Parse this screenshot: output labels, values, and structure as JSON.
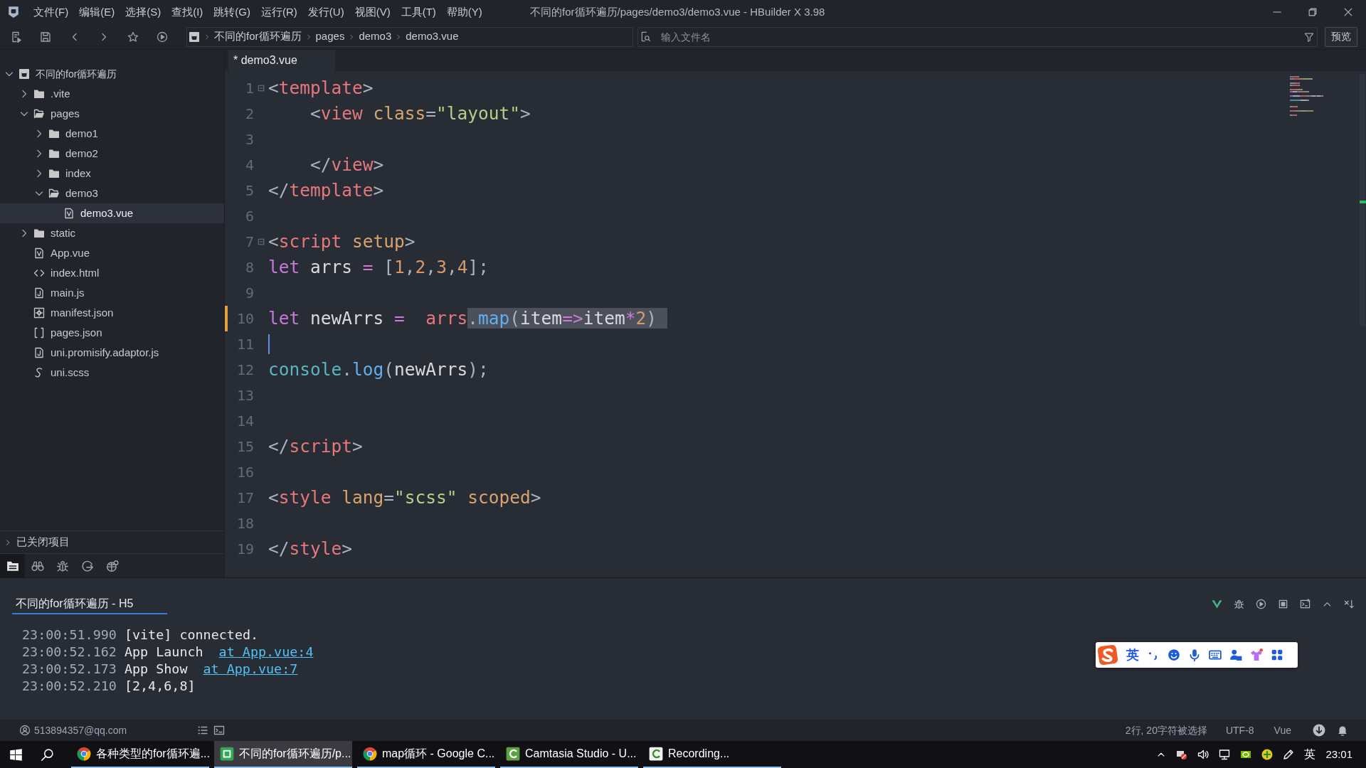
{
  "title_bar": {
    "menu": [
      "文件(F)",
      "编辑(E)",
      "选择(S)",
      "查找(I)",
      "跳转(G)",
      "运行(R)",
      "发行(U)",
      "视图(V)",
      "工具(T)",
      "帮助(Y)"
    ],
    "title": "不同的for循环遍历/pages/demo3/demo3.vue - HBuilder X 3.98"
  },
  "toolbar": {
    "breadcrumb": [
      "不同的for循环遍历",
      "pages",
      "demo3",
      "demo3.vue"
    ],
    "file_search": {
      "placeholder": "输入文件名"
    },
    "preview_button": "预览"
  },
  "sidebar": {
    "tree": [
      {
        "label": "不同的for循环遍历",
        "kind": "project",
        "expanded": true,
        "selected": false,
        "children": [
          {
            "label": ".vite",
            "kind": "folder",
            "expanded": false,
            "selected": false
          },
          {
            "label": "pages",
            "kind": "folder",
            "expanded": true,
            "selected": false,
            "children": [
              {
                "label": "demo1",
                "kind": "folder",
                "expanded": false,
                "selected": false
              },
              {
                "label": "demo2",
                "kind": "folder",
                "expanded": false,
                "selected": false
              },
              {
                "label": "index",
                "kind": "folder",
                "expanded": false,
                "selected": false
              },
              {
                "label": "demo3",
                "kind": "folder",
                "expanded": true,
                "selected": false,
                "children": [
                  {
                    "label": "demo3.vue",
                    "kind": "vue",
                    "selected": true
                  }
                ]
              }
            ]
          },
          {
            "label": "static",
            "kind": "folder",
            "expanded": false,
            "selected": false
          },
          {
            "label": "App.vue",
            "kind": "vue",
            "selected": false
          },
          {
            "label": "index.html",
            "kind": "html",
            "selected": false
          },
          {
            "label": "main.js",
            "kind": "js",
            "selected": false
          },
          {
            "label": "manifest.json",
            "kind": "manifest",
            "selected": false
          },
          {
            "label": "pages.json",
            "kind": "json",
            "selected": false
          },
          {
            "label": "uni.promisify.adaptor.js",
            "kind": "js",
            "selected": false
          },
          {
            "label": "uni.scss",
            "kind": "scss",
            "selected": false
          }
        ]
      }
    ],
    "closed_projects": {
      "label": "已关闭项目",
      "expanded": false
    },
    "bottom_tabs": [
      {
        "kind": "files",
        "selected": true
      },
      {
        "kind": "search",
        "selected": false
      },
      {
        "kind": "debug",
        "selected": false
      },
      {
        "kind": "publish",
        "selected": false
      },
      {
        "kind": "plugins",
        "selected": false
      }
    ]
  },
  "editor": {
    "tabs": [
      {
        "label": "* demo3.vue",
        "selected": true
      }
    ],
    "lines": [
      {
        "number": "1",
        "fold": true,
        "tokens": [
          {
            "text": "<",
            "kind": "punct"
          },
          {
            "text": "template",
            "kind": "tag"
          },
          {
            "text": ">",
            "kind": "punct"
          }
        ]
      },
      {
        "number": "2",
        "tokens": [
          {
            "text": "    <",
            "kind": "punct"
          },
          {
            "text": "view",
            "kind": "tag"
          },
          {
            "text": " class",
            "kind": "attr"
          },
          {
            "text": "=",
            "kind": "punct"
          },
          {
            "text": "\"layout\"",
            "kind": "string"
          },
          {
            "text": ">",
            "kind": "punct"
          }
        ]
      },
      {
        "number": "3"
      },
      {
        "number": "4",
        "tokens": [
          {
            "text": "    </",
            "kind": "punct"
          },
          {
            "text": "view",
            "kind": "tag"
          },
          {
            "text": ">",
            "kind": "punct"
          }
        ]
      },
      {
        "number": "5",
        "tokens": [
          {
            "text": "</",
            "kind": "punct"
          },
          {
            "text": "template",
            "kind": "tag"
          },
          {
            "text": ">",
            "kind": "punct"
          }
        ]
      },
      {
        "number": "6"
      },
      {
        "number": "7",
        "fold": true,
        "tokens": [
          {
            "text": "<",
            "kind": "punct"
          },
          {
            "text": "script",
            "kind": "tag"
          },
          {
            "text": " setup",
            "kind": "attr"
          },
          {
            "text": ">",
            "kind": "punct"
          }
        ]
      },
      {
        "number": "8",
        "tokens": [
          {
            "text": "let",
            "kind": "keyword"
          },
          {
            "text": " arrs",
            "kind": "ident"
          },
          {
            "text": " =",
            "kind": "operator"
          },
          {
            "text": " [",
            "kind": "punct"
          },
          {
            "text": "1",
            "kind": "number"
          },
          {
            "text": ",",
            "kind": "punct"
          },
          {
            "text": "2",
            "kind": "number"
          },
          {
            "text": ",",
            "kind": "punct"
          },
          {
            "text": "3",
            "kind": "number"
          },
          {
            "text": ",",
            "kind": "punct"
          },
          {
            "text": "4",
            "kind": "number"
          },
          {
            "text": "];",
            "kind": "punct"
          }
        ]
      },
      {
        "number": "9"
      },
      {
        "number": "10",
        "modified": true,
        "tokens": [
          {
            "text": "let",
            "kind": "keyword",
            "selected": false
          },
          {
            "text": " newArrs",
            "kind": "ident",
            "selected": false
          },
          {
            "text": " =",
            "kind": "operator",
            "selected": false
          },
          {
            "text": "  arrs",
            "kind": "reference",
            "selected": false
          },
          {
            "text": ".",
            "kind": "punct",
            "selected": true
          },
          {
            "text": "map",
            "kind": "method",
            "selected": true
          },
          {
            "text": "(",
            "kind": "punct",
            "selected": true
          },
          {
            "text": "item",
            "kind": "ident",
            "selected": true
          },
          {
            "text": "=>",
            "kind": "operator",
            "selected": true
          },
          {
            "text": "item",
            "kind": "ident",
            "selected": true
          },
          {
            "text": "*",
            "kind": "operator",
            "selected": true
          },
          {
            "text": "2",
            "kind": "number",
            "selected": true
          },
          {
            "text": ")",
            "kind": "punct",
            "selected": true
          }
        ]
      },
      {
        "number": "11",
        "cursor": true
      },
      {
        "number": "12",
        "tokens": [
          {
            "text": "console",
            "kind": "object"
          },
          {
            "text": ".",
            "kind": "punct"
          },
          {
            "text": "log",
            "kind": "method"
          },
          {
            "text": "(",
            "kind": "punct"
          },
          {
            "text": "newArrs",
            "kind": "ident"
          },
          {
            "text": ");",
            "kind": "punct"
          }
        ]
      },
      {
        "number": "13"
      },
      {
        "number": "14"
      },
      {
        "number": "15",
        "tokens": [
          {
            "text": "</",
            "kind": "punct"
          },
          {
            "text": "script",
            "kind": "tag"
          },
          {
            "text": ">",
            "kind": "punct"
          }
        ]
      },
      {
        "number": "16"
      },
      {
        "number": "17",
        "tokens": [
          {
            "text": "<",
            "kind": "punct"
          },
          {
            "text": "style",
            "kind": "tag"
          },
          {
            "text": " lang",
            "kind": "attr"
          },
          {
            "text": "=",
            "kind": "punct"
          },
          {
            "text": "\"scss\"",
            "kind": "string"
          },
          {
            "text": " scoped",
            "kind": "attr"
          },
          {
            "text": ">",
            "kind": "punct"
          }
        ]
      },
      {
        "number": "18"
      },
      {
        "number": "19",
        "tokens": [
          {
            "text": "</",
            "kind": "punct"
          },
          {
            "text": "style",
            "kind": "tag"
          },
          {
            "text": ">",
            "kind": "punct"
          }
        ]
      }
    ]
  },
  "console": {
    "tabs": [
      {
        "label": "不同的for循环遍历 - H5",
        "selected": true
      }
    ],
    "lines": [
      {
        "time": "23:00:51.990",
        "message": "[vite] connected."
      },
      {
        "time": "23:00:52.162",
        "message": "App Launch",
        "link": "at App.vue:4"
      },
      {
        "time": "23:00:52.173",
        "message": "App Show",
        "link": "at App.vue:7"
      },
      {
        "time": "23:00:52.210",
        "message": "[2,4,6,8]"
      }
    ]
  },
  "ime_bar": {
    "mode": "英"
  },
  "status_bar": {
    "account": "513894357@qq.com",
    "selection": "2行, 20字符被选择",
    "encoding": "UTF-8",
    "language": "Vue"
  },
  "taskbar": {
    "apps": [
      {
        "label": "各种类型的for循环遍...",
        "kind": "chrome",
        "selected": false
      },
      {
        "label": "不同的for循环遍历/p...",
        "kind": "hbuilder",
        "selected": true
      },
      {
        "label": "map循环 - Google C...",
        "kind": "chrome",
        "selected": false
      },
      {
        "label": "Camtasia Studio - U...",
        "kind": "camtasia",
        "selected": false
      },
      {
        "label": "Recording...",
        "kind": "recorder",
        "selected": false
      }
    ],
    "tray": {
      "input_mode": "英",
      "time": "23:01"
    }
  }
}
